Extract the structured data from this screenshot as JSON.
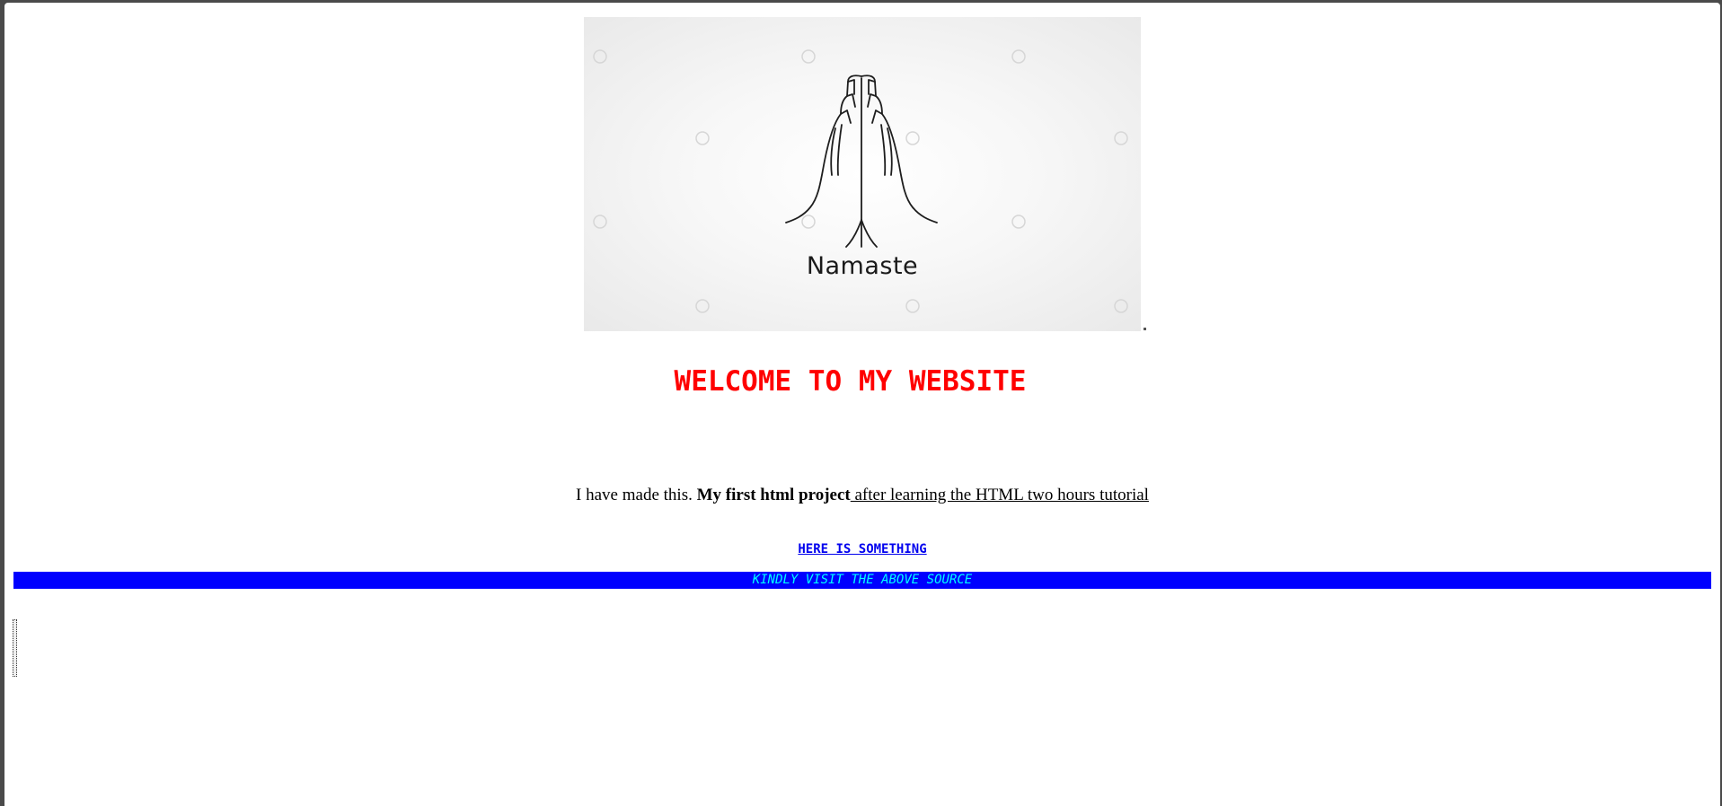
{
  "banner": {
    "image_text": "Namaste",
    "icon": "namaste-hands-icon"
  },
  "welcome_heading": "WELCOME TO MY WEBSITE",
  "intro": {
    "plain": "I have made this. ",
    "bold": "My first html project",
    "underlined": " after learning the HTML two hours tutorial"
  },
  "link_text": "HERE IS SOMETHING ",
  "marquee_text": "KINDLY VISIT THE ABOVE SOURCE",
  "colors": {
    "heading": "#ff0000",
    "link": "#0000ee",
    "bar_background": "#0000ff",
    "bar_text": "#00ffff"
  }
}
